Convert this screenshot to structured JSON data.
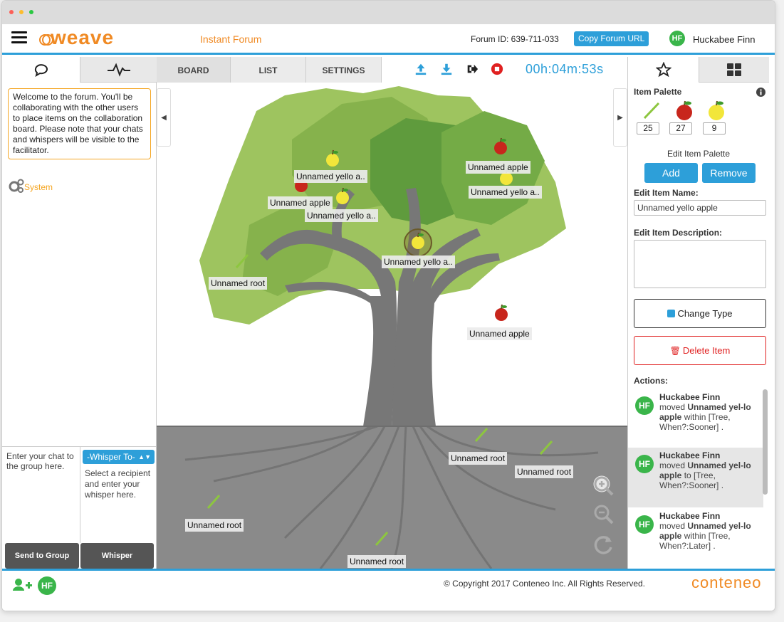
{
  "header": {
    "app_name": "weave",
    "subtitle": "Instant Forum",
    "forum_id": "Forum ID: 639-711-033",
    "copy_url": "Copy Forum URL",
    "user_initials": "HF",
    "user_name": "Huckabee Finn"
  },
  "left": {
    "welcome_message": "Welcome to the forum. You'll be collaborating with the other users to place items on the collaboration board. Please note that your chats and whispers will be visible to the facilitator.",
    "system_label": "System",
    "chat_placeholder": "Enter your chat to the group here.",
    "whisper_to": "-Whisper To-",
    "whisper_hint": "Select a recipient and enter your whisper here.",
    "send_group": "Send to Group",
    "whisper": "Whisper"
  },
  "center": {
    "tabs": [
      "BOARD",
      "LIST",
      "SETTINGS"
    ],
    "active_tab": "BOARD",
    "timer": "00h:04m:53s",
    "items": [
      {
        "label": "Unnamed yello a.."
      },
      {
        "label": "Unnamed apple"
      },
      {
        "label": "Unnamed yello a.."
      },
      {
        "label": "Unnamed apple"
      },
      {
        "label": "Unnamed yello a.."
      },
      {
        "label": "Unnamed yello a.."
      },
      {
        "label": "Unnamed root"
      },
      {
        "label": "Unnamed apple"
      },
      {
        "label": "Unnamed root"
      },
      {
        "label": "Unnamed root"
      },
      {
        "label": "Unnamed root"
      },
      {
        "label": "Unnamed root"
      }
    ]
  },
  "right": {
    "palette_title": "Item Palette",
    "palette_counts": [
      "25",
      "27",
      "9"
    ],
    "edit_palette": "Edit Item Palette",
    "add": "Add",
    "remove": "Remove",
    "edit_name_label": "Edit Item Name:",
    "item_name_value": "Unnamed yello apple",
    "edit_desc_label": "Edit Item Description:",
    "change_type": "Change Type",
    "delete_item": "Delete Item",
    "actions_label": "Actions:",
    "actions": [
      {
        "initials": "HF",
        "name": "Huckabee Finn",
        "verb": "moved",
        "item": "Unnamed yel-lo apple",
        "rest": "within [Tree, When?:Sooner] ."
      },
      {
        "initials": "HF",
        "name": "Huckabee Finn",
        "verb": "moved",
        "item": "Unnamed yel-lo apple",
        "rest": "to [Tree, When?:Sooner] ."
      },
      {
        "initials": "HF",
        "name": "Huckabee Finn",
        "verb": "moved",
        "item": "Unnamed yel-lo apple",
        "rest": "within [Tree, When?:Later] ."
      }
    ]
  },
  "footer": {
    "initials": "HF",
    "copyright": "© Copyright 2017 Conteneo Inc. All Rights Reserved.",
    "brand": "conteneo"
  },
  "colors": {
    "accent_blue": "#2d9fd9",
    "brand_orange": "#f08a24",
    "avatar_green": "#3ab54a",
    "delete_red": "#e02020"
  }
}
